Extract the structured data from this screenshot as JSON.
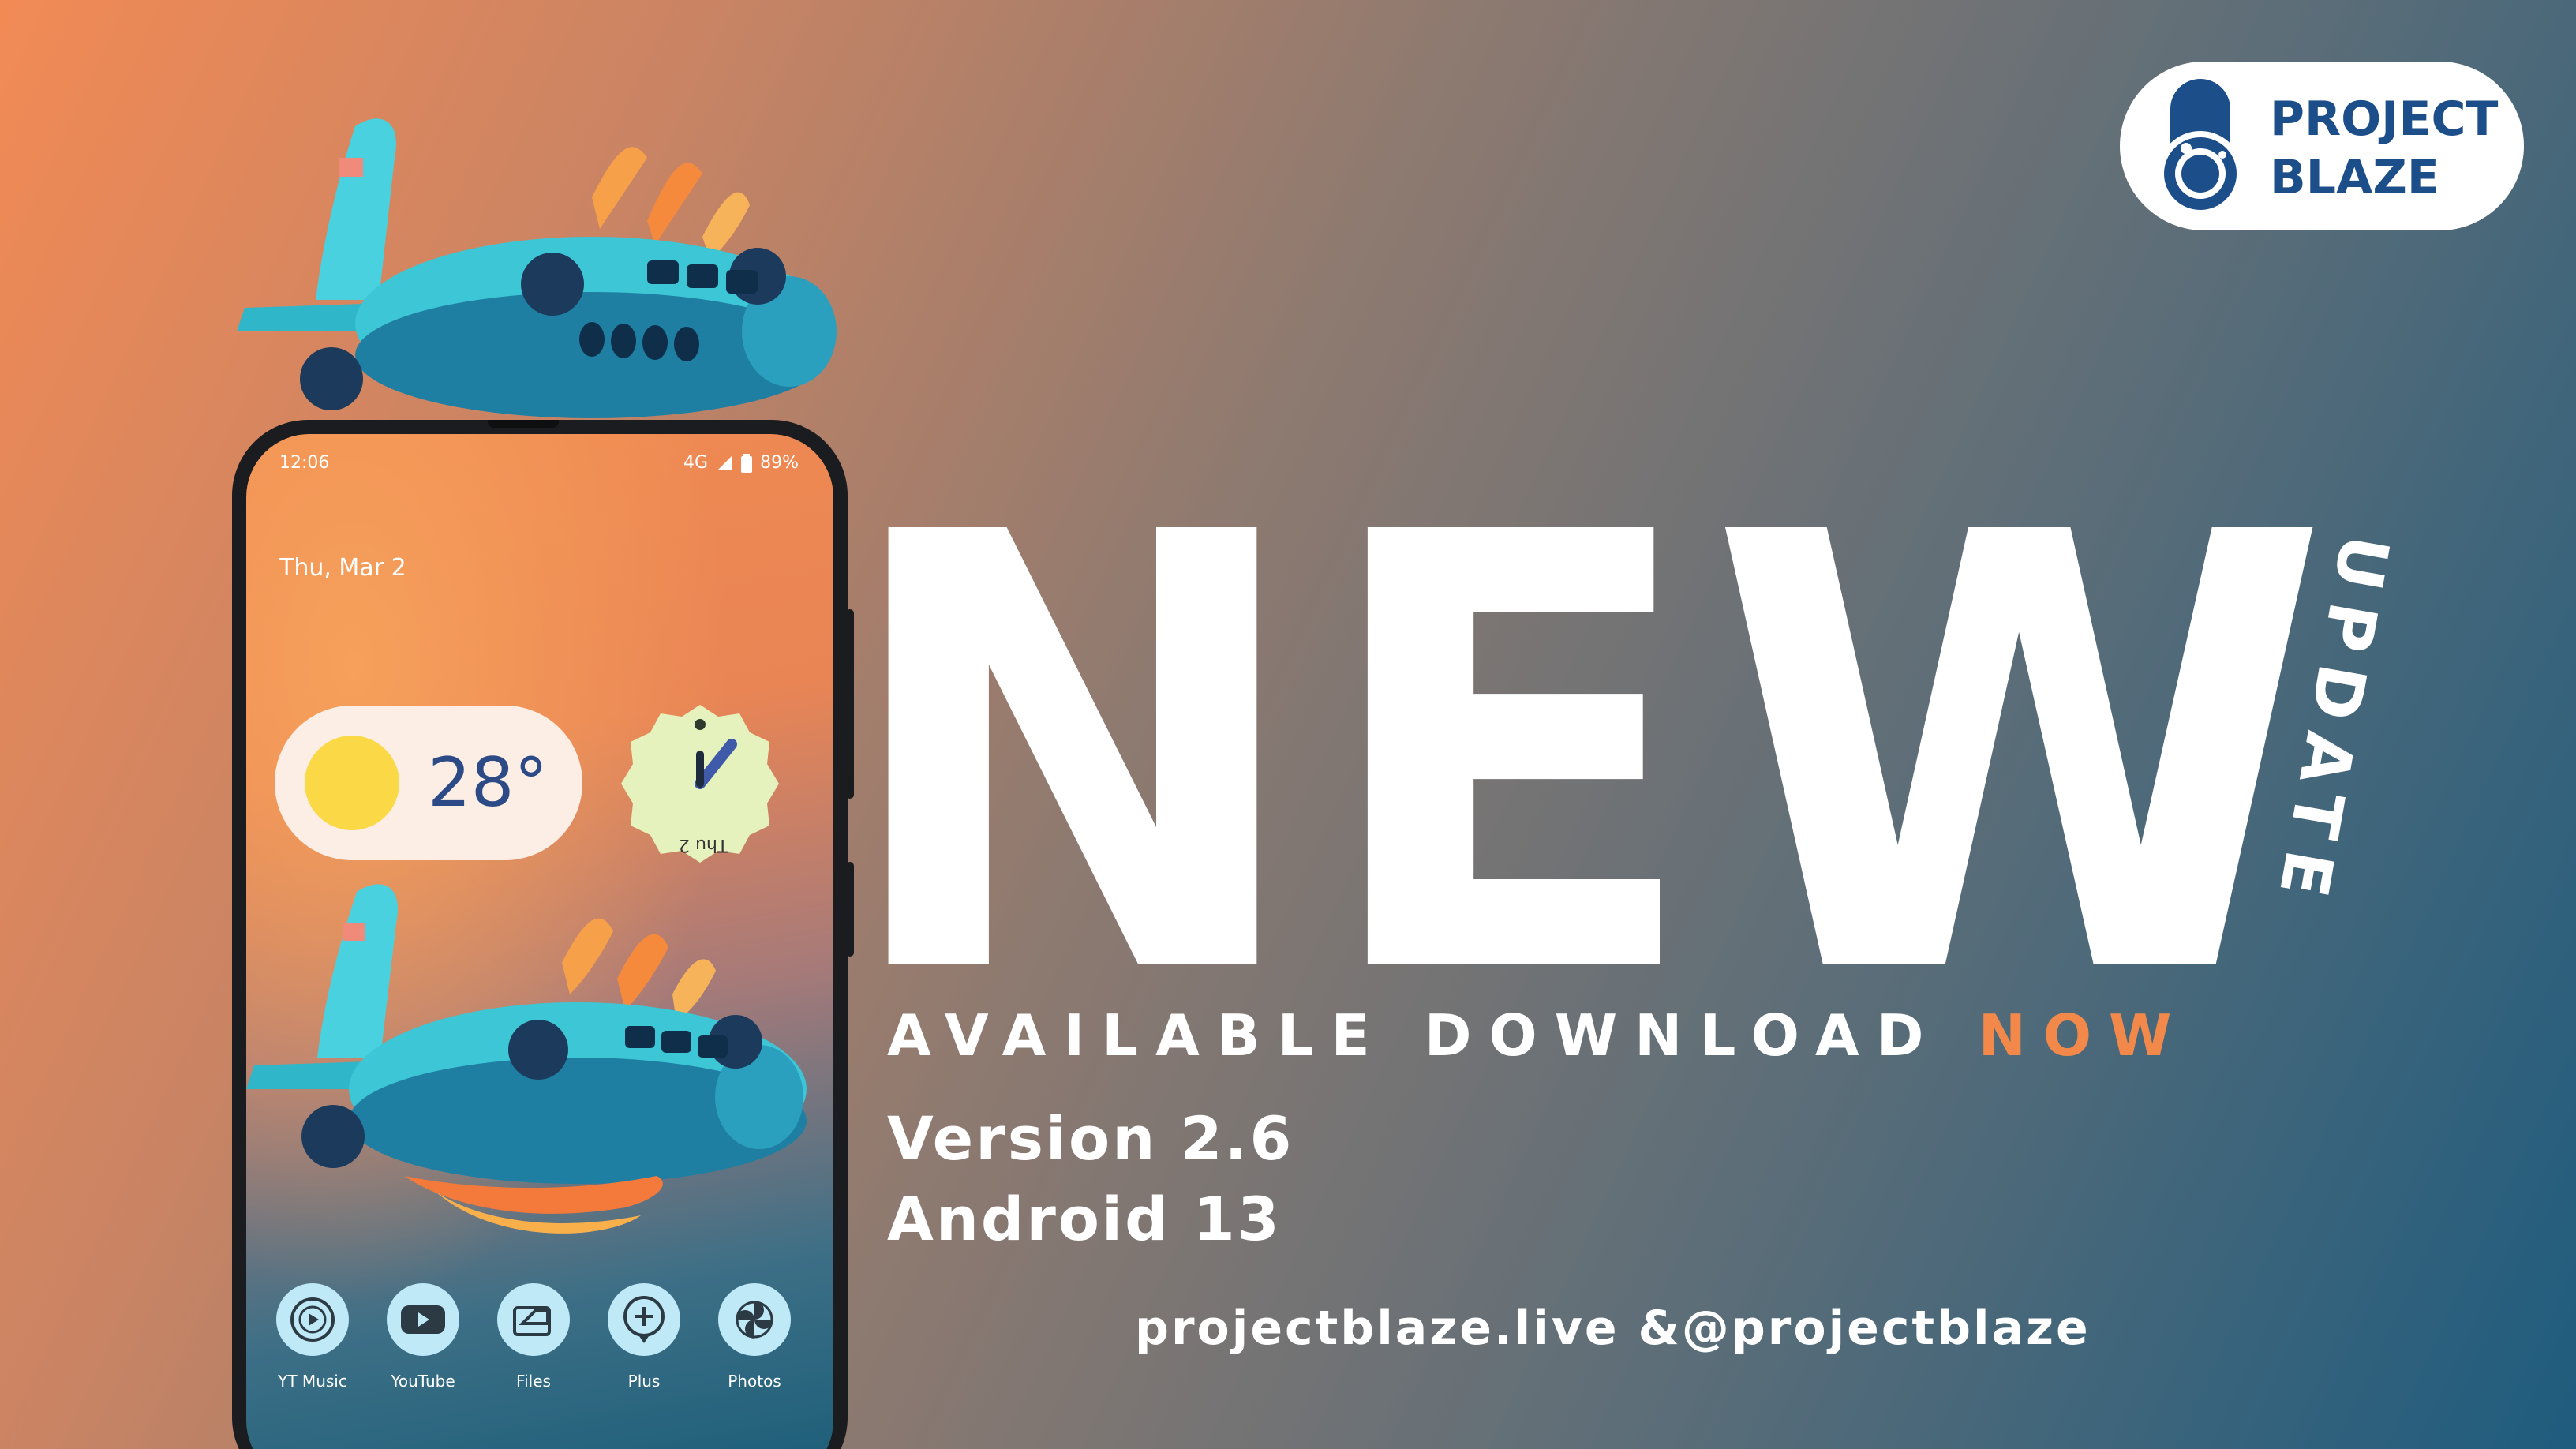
{
  "brand": {
    "line1": "PROJECT",
    "line2": "BLAZE"
  },
  "headline": {
    "main": "NEW",
    "vertical": "UPDATE",
    "available_prefix": "AVAILABLE DOWNLOAD ",
    "available_highlight": "NOW"
  },
  "release": {
    "version": "Version  2.6",
    "android": "Android 13"
  },
  "website": "projectblaze.live &@projectblaze",
  "phone": {
    "status": {
      "time": "12:06",
      "network": "4G",
      "battery": "89%"
    },
    "date": "Thu, Mar 2",
    "weather": {
      "temperature": "28°"
    },
    "clock_date": "Thu 2",
    "dock": [
      {
        "label": "YT Music",
        "icon": "yt-music-icon"
      },
      {
        "label": "YouTube",
        "icon": "youtube-icon"
      },
      {
        "label": "Files",
        "icon": "files-icon"
      },
      {
        "label": "Plus",
        "icon": "plus-icon"
      },
      {
        "label": "Photos",
        "icon": "photos-icon"
      }
    ]
  },
  "colors": {
    "accent_orange": "#f2894a",
    "brand_blue": "#1c4e8a",
    "widget_sun": "#fbd946",
    "dock_icon_bg": "#bfe9f7"
  }
}
